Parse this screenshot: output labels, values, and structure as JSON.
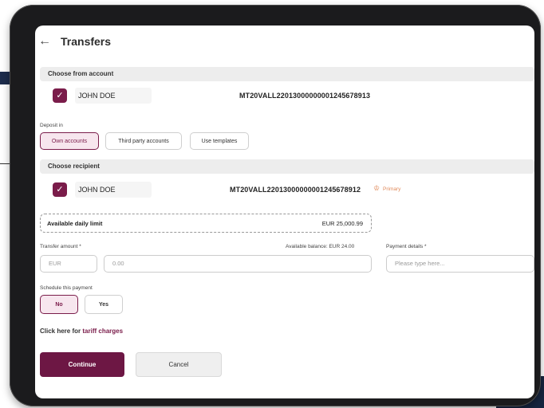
{
  "header": {
    "title": "Transfers",
    "back_icon": "arrow-left-icon"
  },
  "from_account": {
    "section_title": "Choose from account",
    "name": "JOHN DOE",
    "iban": "MT20VALL22013000000001245678913"
  },
  "deposit": {
    "label": "Deposit in",
    "options": [
      "Own accounts",
      "Third party accounts",
      "Use templates"
    ],
    "selected": "Own accounts"
  },
  "recipient": {
    "section_title": "Choose recipient",
    "name": "JOHN DOE",
    "iban": "MT20VALL22013000000001245678912",
    "badge": "Primary"
  },
  "limit": {
    "label": "Available daily limit",
    "value": "EUR 25,000.99"
  },
  "transfer": {
    "amount_label": "Transfer amount *",
    "available_balance": "Available balance: EUR 24.00",
    "currency": "EUR",
    "amount_placeholder": "0.00",
    "details_label": "Payment details *",
    "details_placeholder": "Please type here..."
  },
  "schedule": {
    "label": "Schedule this payment",
    "no": "No",
    "yes": "Yes",
    "selected": "No"
  },
  "tariff": {
    "prefix": "Click here for",
    "link": "tariff charges"
  },
  "actions": {
    "continue": "Continue",
    "cancel": "Cancel"
  },
  "colors": {
    "accent": "#7a1c4a",
    "button": "#6d1744",
    "badge": "#e08a5a"
  }
}
